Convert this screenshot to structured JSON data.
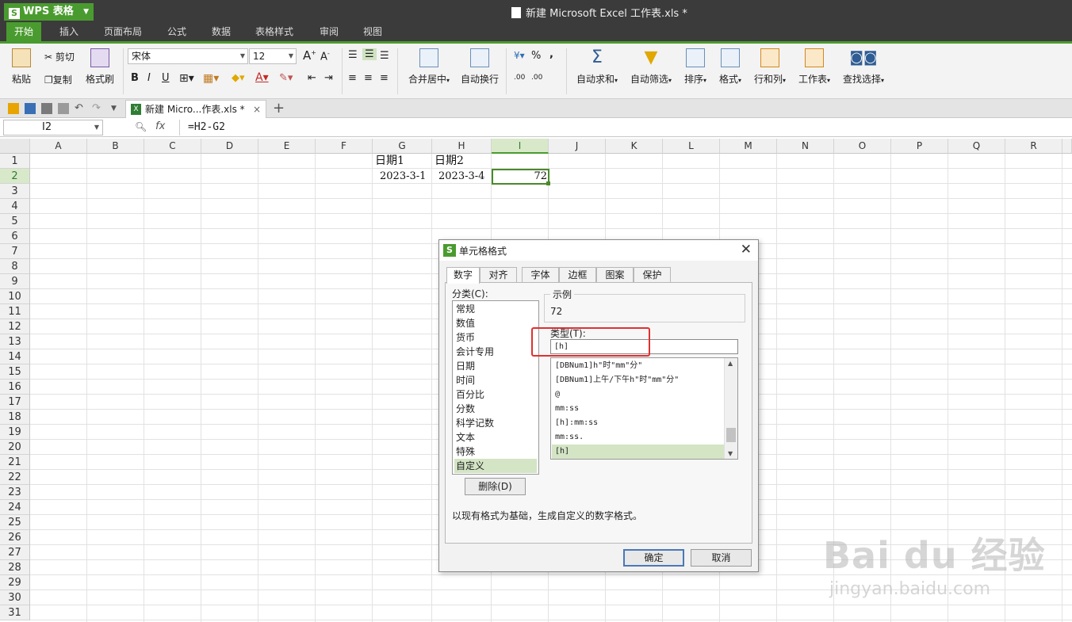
{
  "titlebar": {
    "app_name": "WPS 表格",
    "doc_title": "新建 Microsoft Excel 工作表.xls *"
  },
  "menu": {
    "tabs": [
      "开始",
      "插入",
      "页面布局",
      "公式",
      "数据",
      "表格样式",
      "审阅",
      "视图"
    ],
    "active": "开始"
  },
  "ribbon": {
    "paste": "粘贴",
    "cut": "剪切",
    "copy": "复制",
    "format_painter": "格式刷",
    "font_name": "宋体",
    "font_size": "12",
    "bold": "B",
    "italic": "I",
    "underline": "U",
    "percent": "%",
    "comma": ",",
    "merge_center": "合并居中",
    "wrap_text": "自动换行",
    "auto_sum": "自动求和",
    "auto_filter": "自动筛选",
    "sort": "排序",
    "format": "格式",
    "row_col": "行和列",
    "worksheet": "工作表",
    "find_select": "查找选择"
  },
  "docbar": {
    "tab_label": "新建 Micro...作表.xls *"
  },
  "formula_bar": {
    "name_box": "I2",
    "fx": "fx",
    "formula": "=H2-G2"
  },
  "grid": {
    "columns": [
      "A",
      "B",
      "C",
      "D",
      "E",
      "F",
      "G",
      "H",
      "I",
      "J",
      "K",
      "L",
      "M",
      "N",
      "O",
      "P",
      "Q",
      "R"
    ],
    "selected_column": "I",
    "rows": [
      "1",
      "2",
      "3",
      "4",
      "5",
      "6",
      "7",
      "8",
      "9",
      "10",
      "11",
      "12",
      "13",
      "14",
      "15",
      "16",
      "17",
      "18",
      "19",
      "20",
      "21",
      "22",
      "23",
      "24",
      "25",
      "26",
      "27",
      "28",
      "29",
      "30",
      "31"
    ],
    "selected_row": "2",
    "cells": {
      "G1": "日期1",
      "H1": "日期2",
      "G2": "2023-3-1",
      "H2": "2023-3-4",
      "I2": "72"
    }
  },
  "dialog": {
    "title": "单元格格式",
    "tabs": [
      "数字",
      "对齐",
      "字体",
      "边框",
      "图案",
      "保护"
    ],
    "active_tab": "数字",
    "category_label": "分类(C):",
    "categories": [
      "常规",
      "数值",
      "货币",
      "会计专用",
      "日期",
      "时间",
      "百分比",
      "分数",
      "科学记数",
      "文本",
      "特殊",
      "自定义"
    ],
    "selected_category": "自定义",
    "sample_label": "示例",
    "sample_value": "72",
    "type_label": "类型(T):",
    "type_value": "[h]",
    "formats": [
      "[DBNum1]h\"时\"mm\"分\"",
      "[DBNum1]上午/下午h\"时\"mm\"分\"",
      "@",
      "mm:ss",
      "[h]:mm:ss",
      "mm:ss.",
      "[h]"
    ],
    "selected_format": "[h]",
    "delete_button": "删除(D)",
    "description": "以现有格式为基础，生成自定义的数字格式。",
    "ok_button": "确定",
    "cancel_button": "取消"
  },
  "watermark": {
    "brand": "Bai du 经验",
    "url": "jingyan.baidu.com"
  },
  "colors": {
    "accent": "#4a9b2f",
    "selection": "#d3e5c4",
    "highlight_box": "#e0312f"
  }
}
